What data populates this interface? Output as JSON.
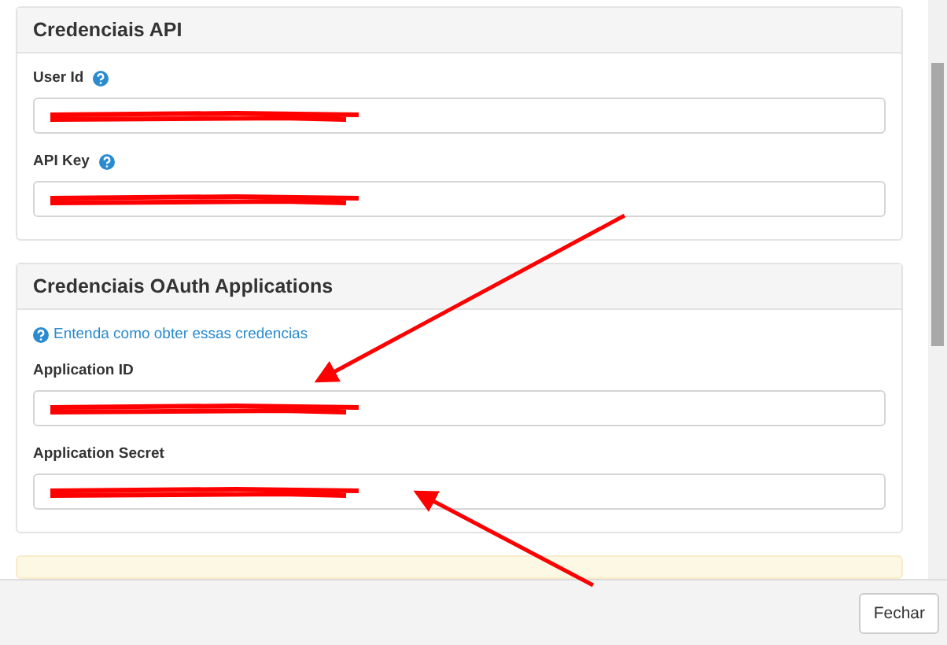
{
  "sections": [
    {
      "title": "Credenciais API",
      "fields": [
        {
          "label": "User Id",
          "help": true,
          "redacted": true
        },
        {
          "label": "API Key",
          "help": true,
          "redacted": true
        }
      ]
    },
    {
      "title": "Credenciais OAuth Applications",
      "help_link": "Entenda como obter essas credencias",
      "fields": [
        {
          "label": "Application ID",
          "help": false,
          "redacted": true
        },
        {
          "label": "Application Secret",
          "help": false,
          "redacted": true
        }
      ]
    }
  ],
  "footer": {
    "buttons": [
      "Fechar"
    ]
  }
}
